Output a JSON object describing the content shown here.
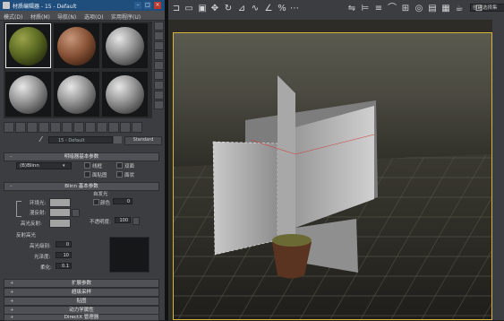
{
  "window": {
    "title": "材质编辑器 - 15 - Default",
    "controls": [
      "–",
      "□",
      "×"
    ]
  },
  "menu": [
    "模式(D)",
    "材质(M)",
    "导航(N)",
    "选项(O)",
    "实用程序(U)"
  ],
  "material": {
    "name": "15 - Default",
    "type_button": "Standard"
  },
  "rollouts": {
    "shader_basic": "明暗器基本参数",
    "shader_value": "(B)Blinn",
    "options": [
      "线框",
      "双面",
      "面贴图",
      "面状"
    ],
    "blinn_basic": "Blinn 基本参数",
    "ambient": "环境光:",
    "diffuse": "漫反射:",
    "specular": "高光反射:",
    "self_illum": "自发光",
    "color_label": "颜色",
    "color_value": "0",
    "opacity_label": "不透明度:",
    "opacity_value": "100",
    "spec_highlights": "反射高光",
    "spec_level_label": "高光级别:",
    "spec_level_value": "0",
    "gloss_label": "光泽度:",
    "gloss_value": "10",
    "soften_label": "柔化:",
    "soften_value": "0.1",
    "collapsed": [
      "扩展参数",
      "超级采样",
      "贴图",
      "动力学属性",
      "DirectX 管理器"
    ]
  },
  "viewport": {
    "selection_set": "创建选择集"
  },
  "colors": {
    "title_bar": "#1f4d7c",
    "panel": "#3b3d41",
    "viewport_border": "#d7b53a"
  }
}
